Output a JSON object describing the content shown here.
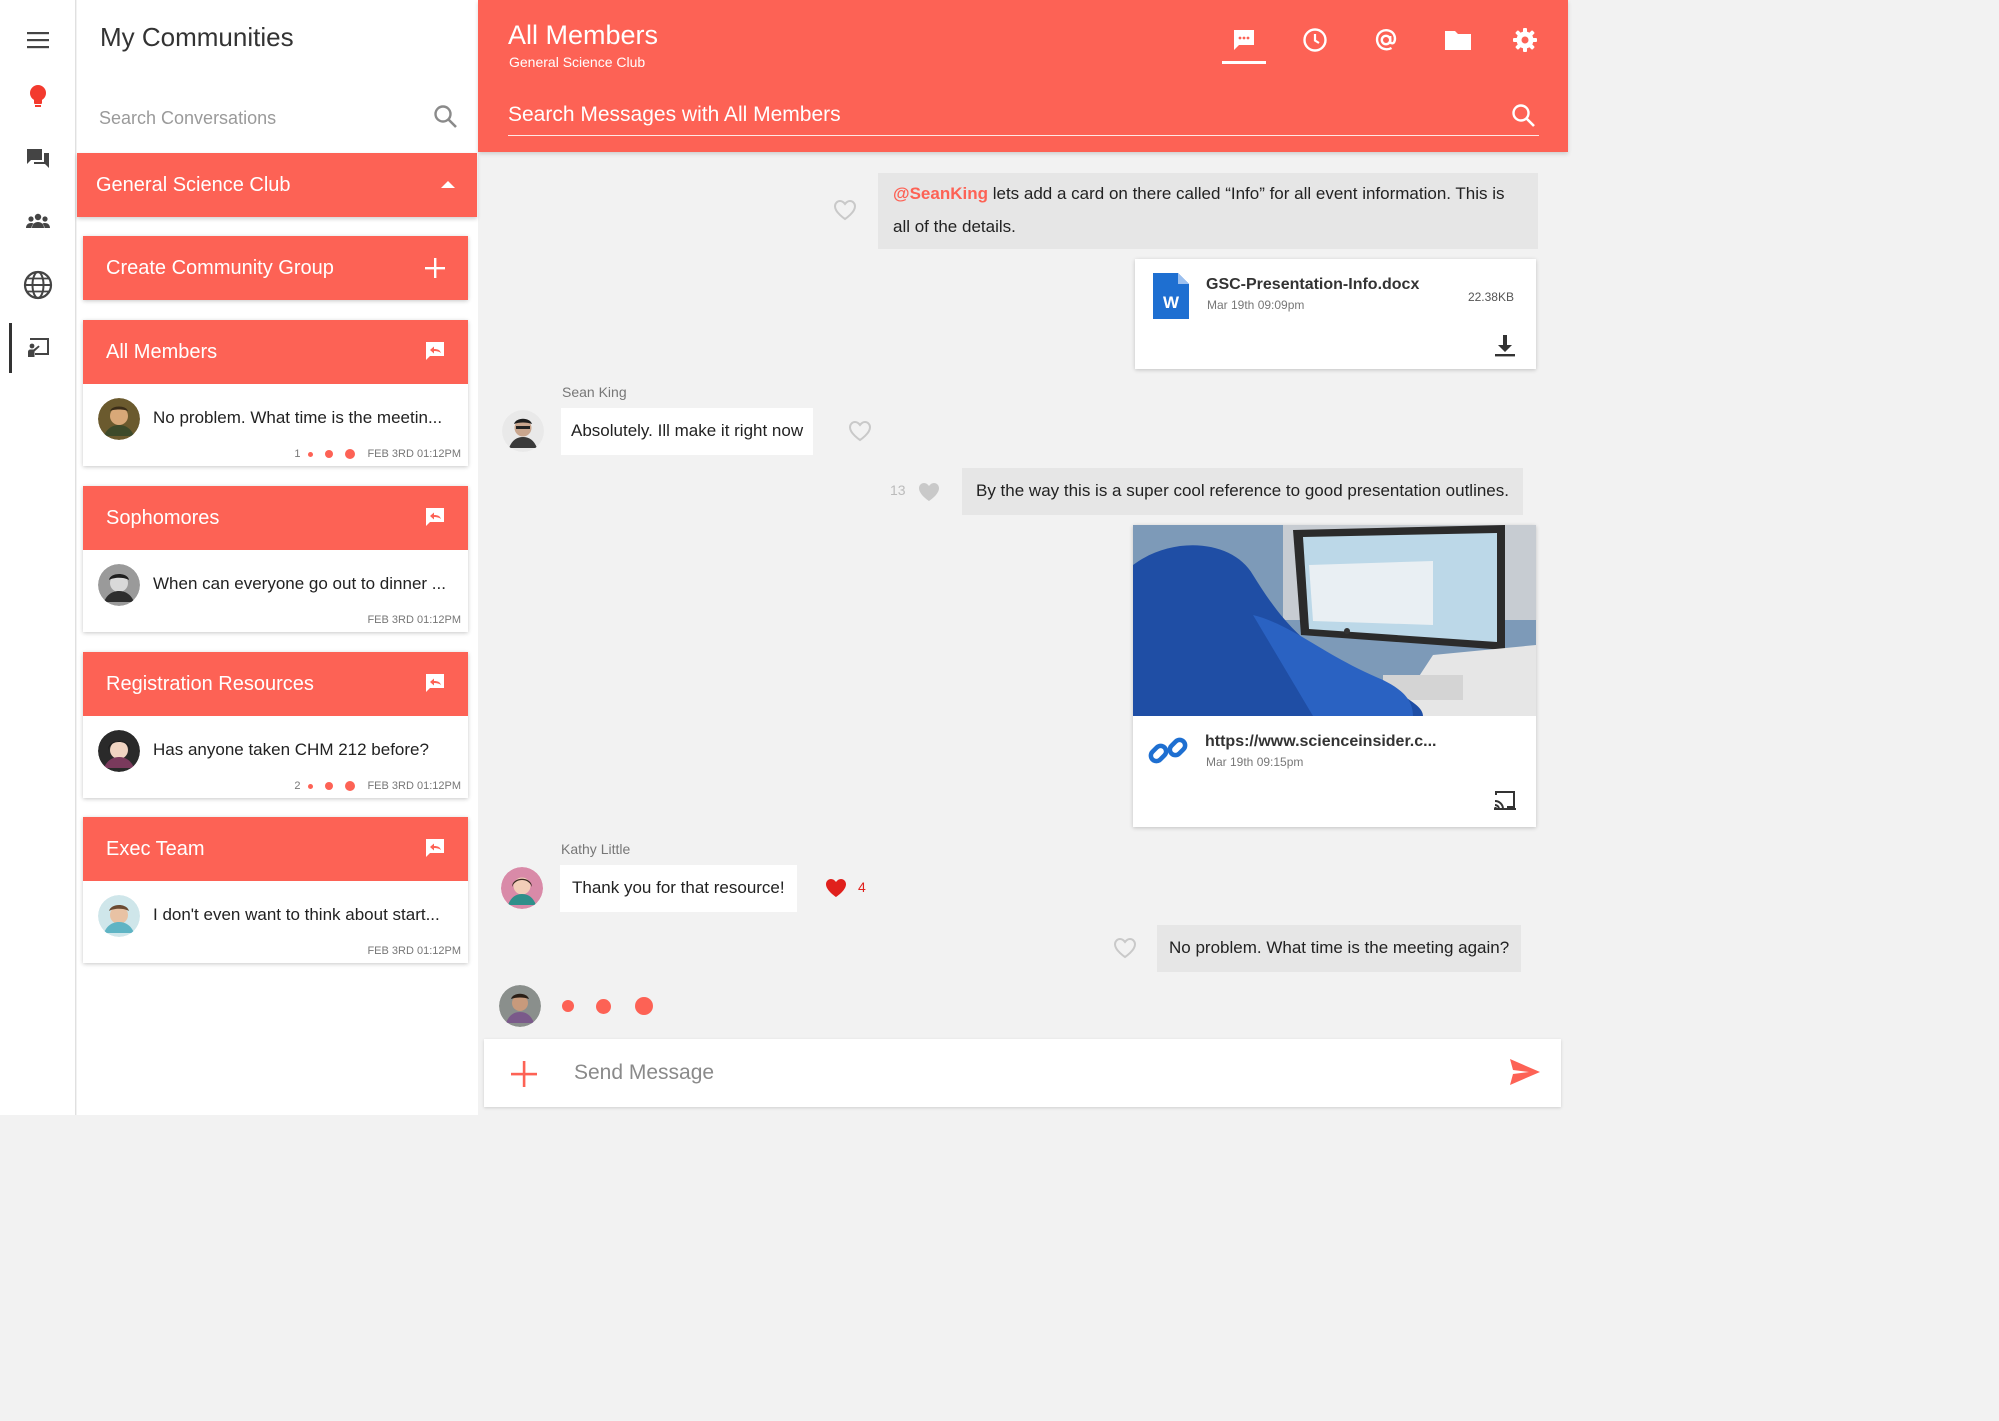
{
  "rail": {
    "items": [
      {
        "icon": "menu-icon"
      },
      {
        "icon": "lightbulb-icon",
        "color": "#f33a2e"
      },
      {
        "icon": "chat-bubbles-icon"
      },
      {
        "icon": "people-icon"
      },
      {
        "icon": "globe-icon"
      },
      {
        "icon": "presentation-icon",
        "active": true
      }
    ]
  },
  "sidebar": {
    "title": "My Communities",
    "search_placeholder": "Search Conversations",
    "community": "General Science Club",
    "create_group_label": "Create Community Group",
    "groups": [
      {
        "name": "All Members",
        "preview": "No problem. What time is the meetin...",
        "unread": "1",
        "timestamp": "FEB 3RD 01:12PM"
      },
      {
        "name": "Sophomores",
        "preview": "When can everyone go out to dinner ...",
        "unread": "",
        "timestamp": "FEB 3RD 01:12PM"
      },
      {
        "name": "Registration Resources",
        "preview": "Has anyone taken CHM 212 before?",
        "unread": "2",
        "timestamp": "FEB 3RD 01:12PM"
      },
      {
        "name": "Exec Team",
        "preview": "I don't even want to think about start...",
        "unread": "",
        "timestamp": "FEB 3RD 01:12PM"
      }
    ]
  },
  "header": {
    "title": "All Members",
    "subtitle": "General Science Club",
    "search_placeholder": "Search Messages with All Members",
    "tabs": [
      "chat-icon",
      "clock-icon",
      "at-icon",
      "folder-icon",
      "gear-icon"
    ]
  },
  "messages": {
    "m1": {
      "mention": "@SeanKing",
      "text": " lets add a card on there called “Info” for all event information. This is all of the details."
    },
    "file": {
      "name": "GSC-Presentation-Info.docx",
      "date": "Mar 19th 09:09pm",
      "size": "22.38KB",
      "badge": "W"
    },
    "m2": {
      "sender": "Sean King",
      "text": "Absolutely. Ill make it right now"
    },
    "m3": {
      "likes": "13",
      "text": "By the way this is a super cool reference to good presentation outlines."
    },
    "link": {
      "url": "https://www.scienceinsider.c...",
      "date": "Mar 19th 09:15pm"
    },
    "m4": {
      "sender": "Kathy Little",
      "text": "Thank you for that resource!",
      "likes": "4"
    },
    "m5": {
      "text": "No problem. What time is the meeting again?"
    }
  },
  "composer": {
    "placeholder": "Send Message"
  },
  "colors": {
    "accent": "#fd6255",
    "heart_active": "#e0201c",
    "word_blue": "#1e6fd1"
  }
}
